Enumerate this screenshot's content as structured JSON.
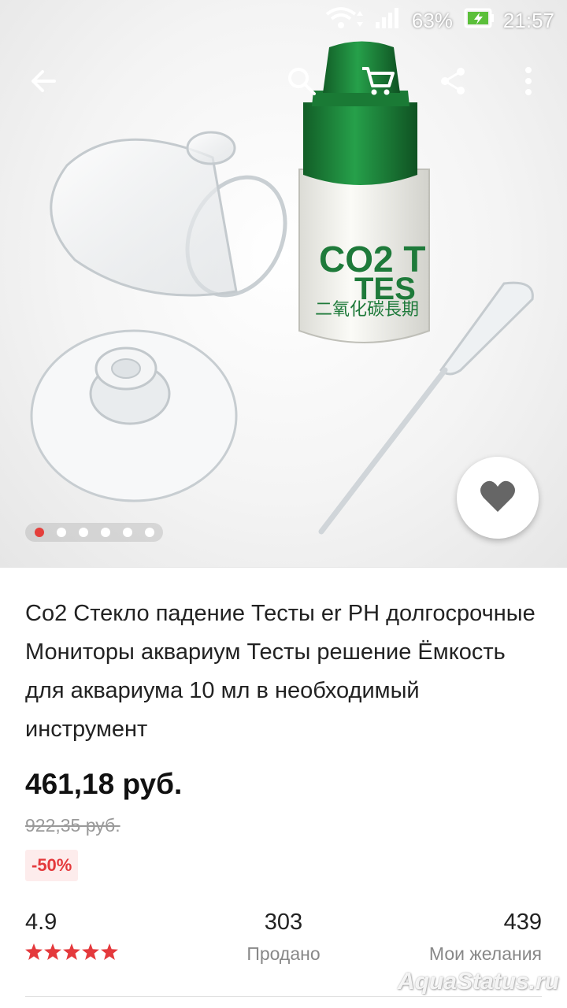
{
  "status_bar": {
    "battery_percent": "63%",
    "time": "21:57",
    "icons": [
      "wifi-icon",
      "signal-icon",
      "battery-charging-icon"
    ]
  },
  "toolbar": {
    "icons": [
      "back-arrow-icon",
      "search-icon",
      "cart-icon",
      "share-icon",
      "more-vert-icon"
    ]
  },
  "gallery": {
    "image_count": 6,
    "active_index": 0,
    "image_text": {
      "bottle_label_line1": "CO2 T",
      "bottle_label_line2": "TES",
      "bottle_label_line3": "二氧化碳長期"
    }
  },
  "wishlist_button": {
    "icon": "heart-icon"
  },
  "product": {
    "title": "Co2 Стекло падение Тесты er PH долгосрочные Мониторы аквариум Тесты решение Ёмкость для аквариума 10 мл в необходимый инструмент",
    "price": "461,18 руб.",
    "old_price": "922,35 руб.",
    "discount": "-50%"
  },
  "stats": {
    "rating": "4.9",
    "stars": 5,
    "sold_count": "303",
    "sold_label": "Продано",
    "wishlist_count": "439",
    "wishlist_label": "Мои желания"
  },
  "watermark": "AquaStatus.ru",
  "colors": {
    "accent": "#e43f3b",
    "cap_green": "#1e8a3c",
    "star": "#e4393c"
  }
}
